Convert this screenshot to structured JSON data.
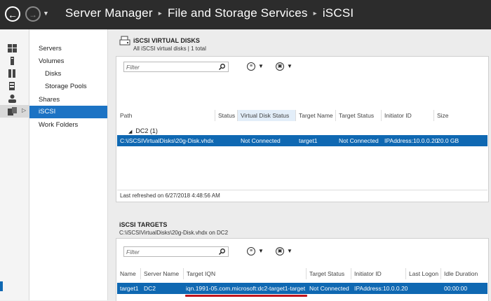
{
  "titlebar": {
    "back_icon": "back-arrow-icon",
    "forward_icon": "forward-arrow-icon",
    "crumbs": [
      "Server Manager",
      "File and Storage Services",
      "iSCSI"
    ],
    "separator": "▸"
  },
  "rail": {
    "icons": [
      "dashboard-icon",
      "local-server-icon",
      "all-servers-icon",
      "file-storage-roles-icon",
      "users-icon",
      "file-storage-services-icon"
    ]
  },
  "subnav": {
    "items": [
      {
        "label": "Servers"
      },
      {
        "label": "Volumes"
      },
      {
        "label": "Disks"
      },
      {
        "label": "Storage Pools"
      },
      {
        "label": "Shares"
      },
      {
        "label": "iSCSI"
      },
      {
        "label": "Work Folders"
      }
    ]
  },
  "virtual_disks": {
    "title": "iSCSI VIRTUAL DISKS",
    "subtitle": "All iSCSI virtual disks | 1 total",
    "filter_placeholder": "Filter",
    "columns": [
      "Path",
      "Status",
      "Virtual Disk Status",
      "Target Name",
      "Target Status",
      "Initiator ID",
      "Size"
    ],
    "group": "DC2 (1)",
    "rows": [
      {
        "path": "C:\\iSCSIVirtualDisks\\20g-Disk.vhdx",
        "status": "",
        "virtual_disk_status": "Not Connected",
        "target_name": "target1",
        "target_status": "Not Connected",
        "initiator_id": "IPAddress:10.0.0.20",
        "size": "20.0 GB"
      }
    ],
    "last_refreshed": "Last refreshed on 6/27/2018 4:48:56 AM"
  },
  "targets": {
    "title": "iSCSI TARGETS",
    "subtitle": "C:\\iSCSIVirtualDisks\\20g-Disk.vhdx on DC2",
    "filter_placeholder": "Filter",
    "columns": [
      "Name",
      "Server Name",
      "Target IQN",
      "Target Status",
      "Initiator ID",
      "Last Logon",
      "Idle Duration"
    ],
    "rows": [
      {
        "name": "target1",
        "server_name": "DC2",
        "target_iqn": "iqn.1991-05.com.microsoft:dc2-target1-target",
        "target_status": "Not Connected",
        "initiator_id": "IPAddress:10.0.0.20",
        "last_logon": "",
        "idle_duration": "00:00:00"
      }
    ]
  },
  "colors": {
    "titlebar_bg": "#2c2c2c",
    "selection": "#0f68b2",
    "nav_selection": "#1c73c4",
    "highlight_mark": "#c0131b"
  }
}
